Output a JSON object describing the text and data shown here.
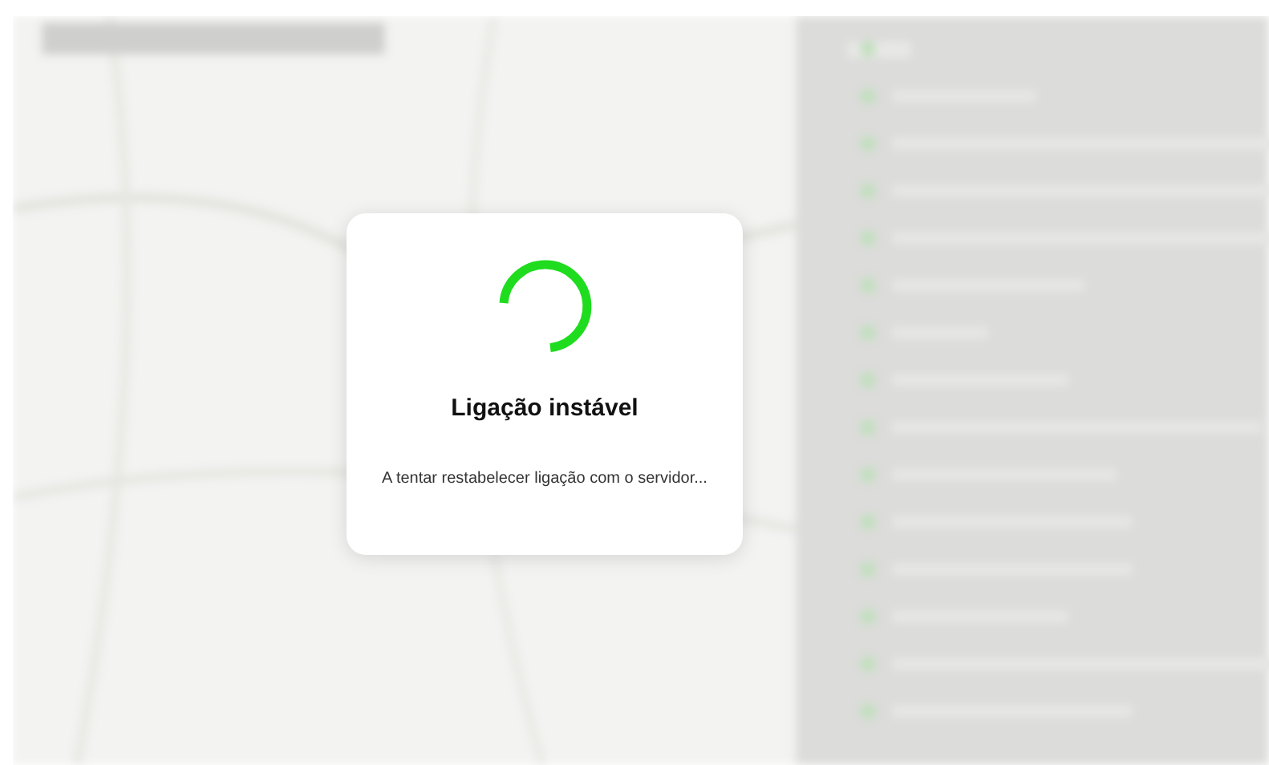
{
  "dialog": {
    "title": "Ligação instável",
    "message": "A tentar restabelecer ligação com o servidor..."
  }
}
